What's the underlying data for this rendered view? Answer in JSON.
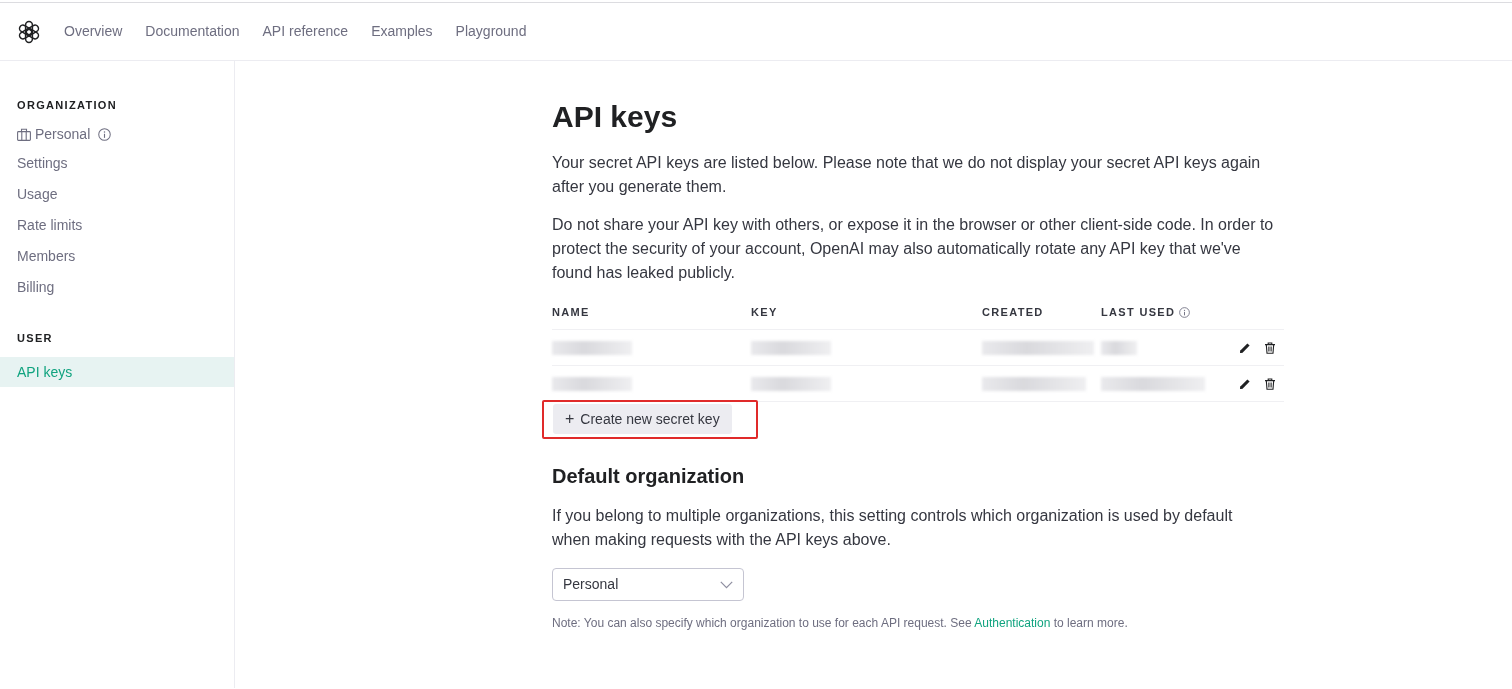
{
  "nav": {
    "items": [
      "Overview",
      "Documentation",
      "API reference",
      "Examples",
      "Playground"
    ]
  },
  "sidebar": {
    "sections": [
      {
        "heading": "ORGANIZATION",
        "items": [
          {
            "label": "Personal",
            "kind": "org",
            "selected": false
          },
          {
            "label": "Settings",
            "kind": "link",
            "selected": false
          },
          {
            "label": "Usage",
            "kind": "link",
            "selected": false
          },
          {
            "label": "Rate limits",
            "kind": "link",
            "selected": false
          },
          {
            "label": "Members",
            "kind": "link",
            "selected": false
          },
          {
            "label": "Billing",
            "kind": "link",
            "selected": false
          }
        ]
      },
      {
        "heading": "USER",
        "items": [
          {
            "label": "API keys",
            "kind": "link",
            "selected": true
          }
        ]
      }
    ]
  },
  "page": {
    "title": "API keys",
    "paragraphs": [
      "Your secret API keys are listed below. Please note that we do not display your secret API keys again after you generate them.",
      "Do not share your API key with others, or expose it in the browser or other client-side code. In order to protect the security of your account, OpenAI may also automatically rotate any API key that we've found has leaked publicly."
    ]
  },
  "table": {
    "columns": [
      {
        "label": "NAME",
        "info": false
      },
      {
        "label": "KEY",
        "info": false
      },
      {
        "label": "CREATED",
        "info": false
      },
      {
        "label": "LAST USED",
        "info": true
      }
    ],
    "rows": [
      {
        "kind": "redacted"
      },
      {
        "kind": "redacted"
      }
    ]
  },
  "create_button": {
    "icon": "+",
    "label": "Create new secret key",
    "highlighted": true
  },
  "default_organization": {
    "heading": "Default organization",
    "description": "If you belong to multiple organizations, this setting controls which organization is used by default when making requests with the API keys above.",
    "select": {
      "value": "Personal"
    },
    "note": {
      "text_before": "Note: You can also specify which organization to use for each API request. See ",
      "link": "Authentication",
      "text_after": " to learn more."
    }
  }
}
